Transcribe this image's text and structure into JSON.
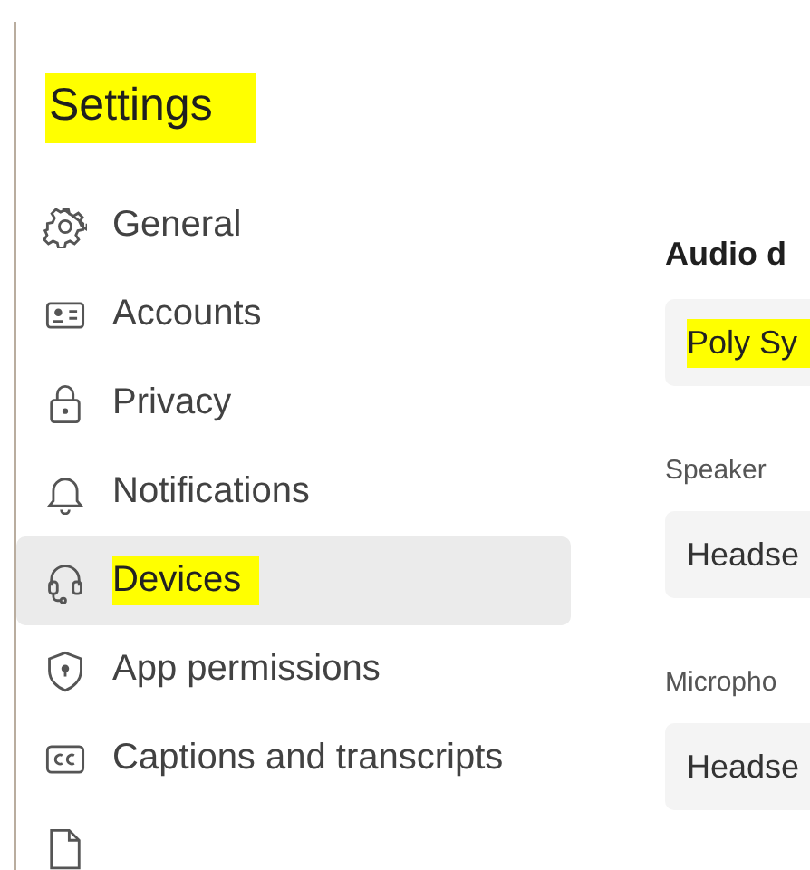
{
  "title": {
    "text": "Settings",
    "highlighted": true
  },
  "nav": [
    {
      "label": "General",
      "selected": false
    },
    {
      "label": "Accounts",
      "selected": false
    },
    {
      "label": "Privacy",
      "selected": false
    },
    {
      "label": "Notifications",
      "selected": false
    },
    {
      "label": "Devices",
      "selected": true,
      "highlighted": true
    },
    {
      "label": "App permissions",
      "selected": false
    },
    {
      "label": "Captions and transcripts",
      "selected": false
    },
    {
      "selected": false
    }
  ],
  "content": {
    "heading": "Audio d",
    "fields": [
      {
        "value": "Poly Sy",
        "highlighted": true
      },
      {
        "label": "Speaker",
        "value": "Headse",
        "highlighted": false
      },
      {
        "label": "Micropho",
        "value": "Headse",
        "highlighted": false
      }
    ]
  }
}
